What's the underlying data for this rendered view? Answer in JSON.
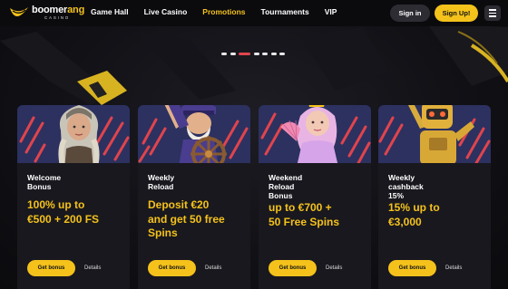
{
  "logo": {
    "brand_start": "boomer",
    "brand_end": "ang",
    "sub": "CASINO"
  },
  "nav": [
    {
      "label": "Game Hall"
    },
    {
      "label": "Live Casino"
    },
    {
      "label": "Promotions"
    },
    {
      "label": "Tournaments"
    },
    {
      "label": "VIP"
    }
  ],
  "header": {
    "signin_label": "Sign in",
    "signup_label": "Sign Up!"
  },
  "carousel": {
    "active_dot": 2,
    "dot_count": 7
  },
  "colors": {
    "accent": "#f4c21b",
    "active_dot": "#e0444c",
    "card_bg": "#1b1a20",
    "card_art_bg": "#2c3160",
    "stripe": "#e0444c"
  },
  "cards": [
    {
      "subtitle": "Welcome\nBonus",
      "title": "100% up to\n€500 + 200 FS",
      "button": "Get bonus",
      "details": "Details",
      "icon": "viking-woman-icon"
    },
    {
      "subtitle": "Weekly\nReload",
      "title": "Deposit €20\nand get 50 free\nSpins",
      "button": "Get bonus",
      "details": "Details",
      "icon": "sea-captain-icon"
    },
    {
      "subtitle": "Weekend\nReload\nBonus",
      "title": "up to €700 +\n50 Free Spins",
      "button": "Get bonus",
      "details": "Details",
      "icon": "princess-icon"
    },
    {
      "subtitle": "Weekly\ncashback\n15%",
      "title": "15% up to\n€3,000",
      "button": "Get bonus",
      "details": "Details",
      "icon": "robot-icon"
    }
  ]
}
